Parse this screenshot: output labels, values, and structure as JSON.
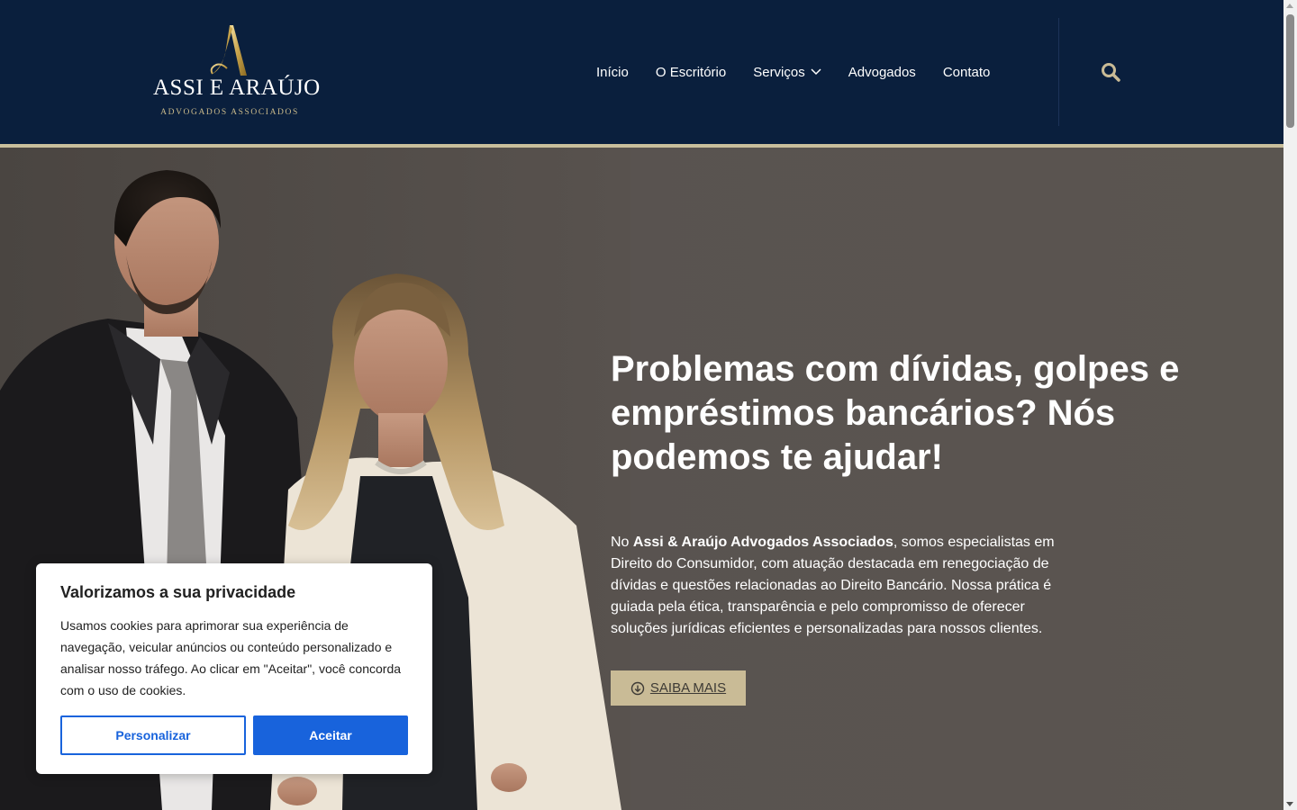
{
  "logo": {
    "title": "ASSI E ARAÚJO",
    "subtitle": "ADVOGADOS ASSOCIADOS",
    "mark": "A"
  },
  "nav": {
    "items": [
      {
        "label": "Início"
      },
      {
        "label": "O Escritório"
      },
      {
        "label": "Serviços"
      },
      {
        "label": "Advogados"
      },
      {
        "label": "Contato"
      }
    ],
    "search_icon": "search-icon"
  },
  "hero": {
    "title": "Problemas com dívidas, golpes e empréstimos bancários? Nós podemos te ajudar!",
    "text_prefix": "No ",
    "text_bold": "Assi & Araújo Advogados Associados",
    "text_rest": ", somos especialistas em Direito do Consumidor, com atuação destacada em renegociação de dívidas e questões relacionadas ao Direito Bancário. Nossa prática é guiada pela ética, transparência e pelo compromisso de oferecer soluções jurídicas eficientes e personalizadas para nossos clientes.",
    "cta_label": "SAIBA MAIS",
    "cta_icon": "arrow-down-circle-icon"
  },
  "cookie": {
    "title": "Valorizamos a sua privacidade",
    "text": "Usamos cookies para aprimorar sua experiência de navegação, veicular anúncios ou conteúdo personalizado e analisar nosso tráfego. Ao clicar em \"Aceitar\", você concorda com o uso de cookies.",
    "customize_label": "Personalizar",
    "accept_label": "Aceitar"
  },
  "colors": {
    "header_bg": "#0a1f3d",
    "gold": "#c9bb96",
    "accept_blue": "#1863dc"
  }
}
